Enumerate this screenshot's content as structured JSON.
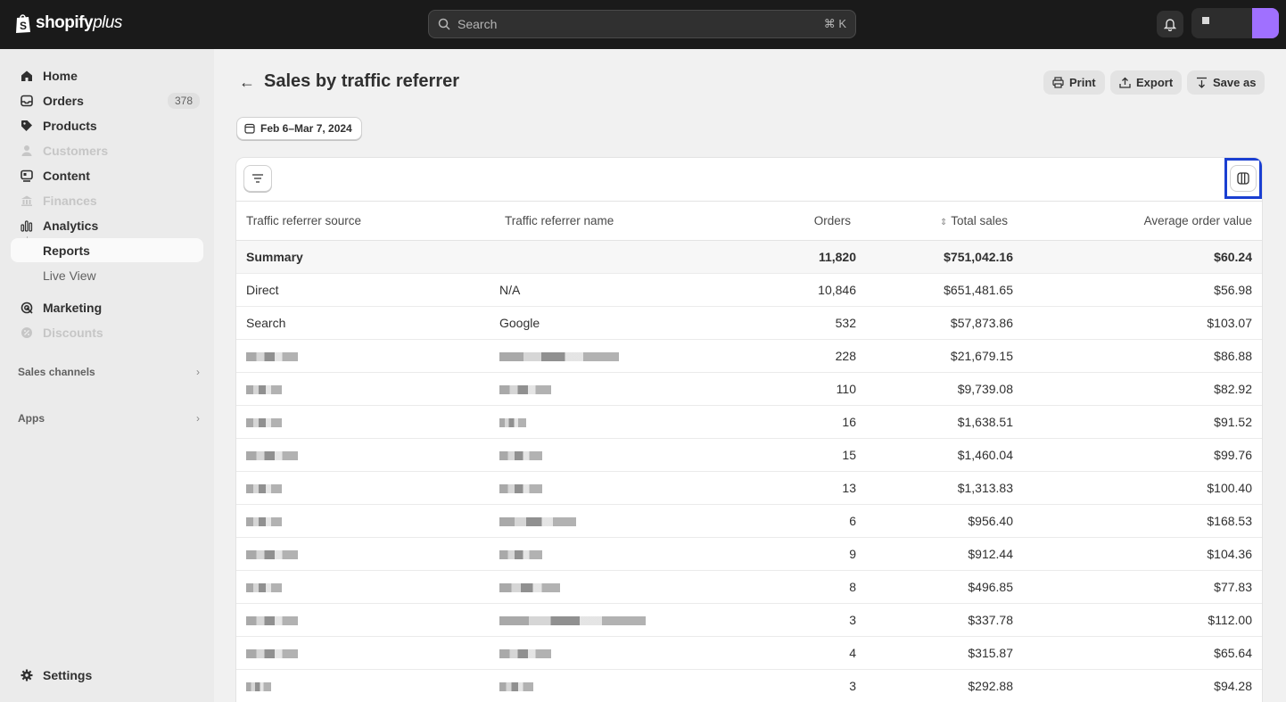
{
  "topbar": {
    "logo_text": "shopify",
    "logo_suffix": "plus",
    "search_placeholder": "Search",
    "search_shortcut": "⌘ K"
  },
  "sidebar": {
    "items": [
      {
        "label": "Home",
        "icon": "home-icon"
      },
      {
        "label": "Orders",
        "icon": "inbox-icon",
        "badge": "378"
      },
      {
        "label": "Products",
        "icon": "tag-icon"
      },
      {
        "label": "Customers",
        "icon": "person-icon",
        "disabled": true
      },
      {
        "label": "Content",
        "icon": "content-icon"
      },
      {
        "label": "Finances",
        "icon": "bank-icon",
        "disabled": true
      },
      {
        "label": "Analytics",
        "icon": "bar-chart-icon"
      },
      {
        "label": "Reports",
        "active": true
      },
      {
        "label": "Live View"
      },
      {
        "label": "Marketing",
        "icon": "target-icon"
      },
      {
        "label": "Discounts",
        "icon": "discount-icon",
        "disabled": true
      }
    ],
    "sales_channels": "Sales channels",
    "apps": "Apps",
    "settings": "Settings"
  },
  "page": {
    "title": "Sales by traffic referrer",
    "actions": {
      "print": "Print",
      "export": "Export",
      "save_as": "Save as"
    },
    "date_range": "Feb 6–Mar 7, 2024"
  },
  "table": {
    "headers": [
      "Traffic referrer source",
      "Traffic referrer name",
      "Orders",
      "Total sales",
      "Average order value"
    ],
    "summary": {
      "label": "Summary",
      "orders": "11,820",
      "total_sales": "$751,042.16",
      "aov": "$60.24"
    },
    "rows": [
      {
        "source": "Direct",
        "name": "N/A",
        "orders": "10,846",
        "total_sales": "$651,481.65",
        "aov": "$56.98"
      },
      {
        "source": "Search",
        "name": "Google",
        "orders": "532",
        "total_sales": "$57,873.86",
        "aov": "$103.07"
      },
      {
        "source": "",
        "name": "",
        "orders": "228",
        "total_sales": "$21,679.15",
        "aov": "$86.88"
      },
      {
        "source": "",
        "name": "",
        "orders": "110",
        "total_sales": "$9,739.08",
        "aov": "$82.92"
      },
      {
        "source": "",
        "name": "",
        "orders": "16",
        "total_sales": "$1,638.51",
        "aov": "$91.52"
      },
      {
        "source": "",
        "name": "",
        "orders": "15",
        "total_sales": "$1,460.04",
        "aov": "$99.76"
      },
      {
        "source": "",
        "name": "",
        "orders": "13",
        "total_sales": "$1,313.83",
        "aov": "$100.40"
      },
      {
        "source": "",
        "name": "",
        "orders": "6",
        "total_sales": "$956.40",
        "aov": "$168.53"
      },
      {
        "source": "",
        "name": "",
        "orders": "9",
        "total_sales": "$912.44",
        "aov": "$104.36"
      },
      {
        "source": "",
        "name": "",
        "orders": "8",
        "total_sales": "$496.85",
        "aov": "$77.83"
      },
      {
        "source": "",
        "name": "",
        "orders": "3",
        "total_sales": "$337.78",
        "aov": "$112.00"
      },
      {
        "source": "",
        "name": "",
        "orders": "4",
        "total_sales": "$315.87",
        "aov": "$65.64"
      },
      {
        "source": "",
        "name": "",
        "orders": "3",
        "total_sales": "$292.88",
        "aov": "$94.28"
      }
    ]
  },
  "colors": {
    "highlight_border": "#1a3fd1",
    "avatar": "#a070ff",
    "topbar": "#1a1a1a"
  }
}
